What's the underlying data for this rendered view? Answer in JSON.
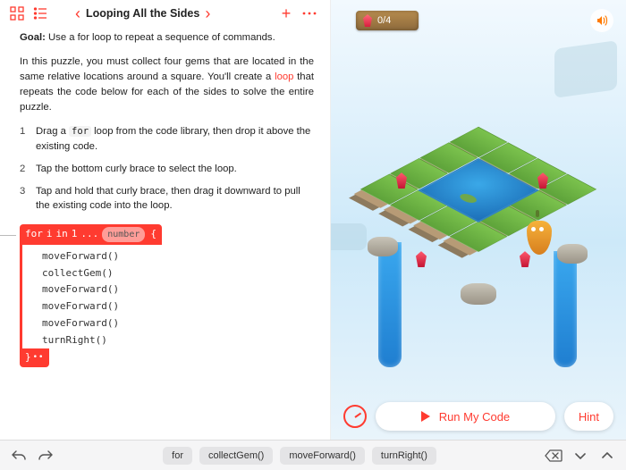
{
  "nav": {
    "title": "Looping All the Sides"
  },
  "goal_label": "Goal:",
  "goal_text": "Use a for loop to repeat a sequence of commands.",
  "intro_pre": "In this puzzle, you must collect four gems that are located in the same relative locations around a square. You'll create a ",
  "intro_link": "loop",
  "intro_post": " that repeats the code below for each of the sides to solve the entire puzzle.",
  "step1_pre": "Drag a ",
  "step1_code": "for",
  "step1_post": " loop from the code library, then drop it above the existing code.",
  "step2": "Tap the bottom curly brace to select the loop.",
  "step3": "Tap and hold that curly brace, then drag it downward to pull the existing code into the loop.",
  "code": {
    "for_kw": "for",
    "for_var": "i",
    "for_in": "in",
    "for_start": "1",
    "for_ellipsis": "...",
    "for_number_placeholder": "number",
    "open_brace": "{",
    "close_brace": "}",
    "continuation": "••",
    "lines": [
      "moveForward()",
      "collectGem()",
      "moveForward()",
      "moveForward()",
      "moveForward()",
      "turnRight()"
    ]
  },
  "scene": {
    "gem_progress": "0/4"
  },
  "controls": {
    "run_label": "Run My Code",
    "hint_label": "Hint"
  },
  "footer": {
    "snippets": [
      "for",
      "collectGem()",
      "moveForward()",
      "turnRight()"
    ]
  }
}
